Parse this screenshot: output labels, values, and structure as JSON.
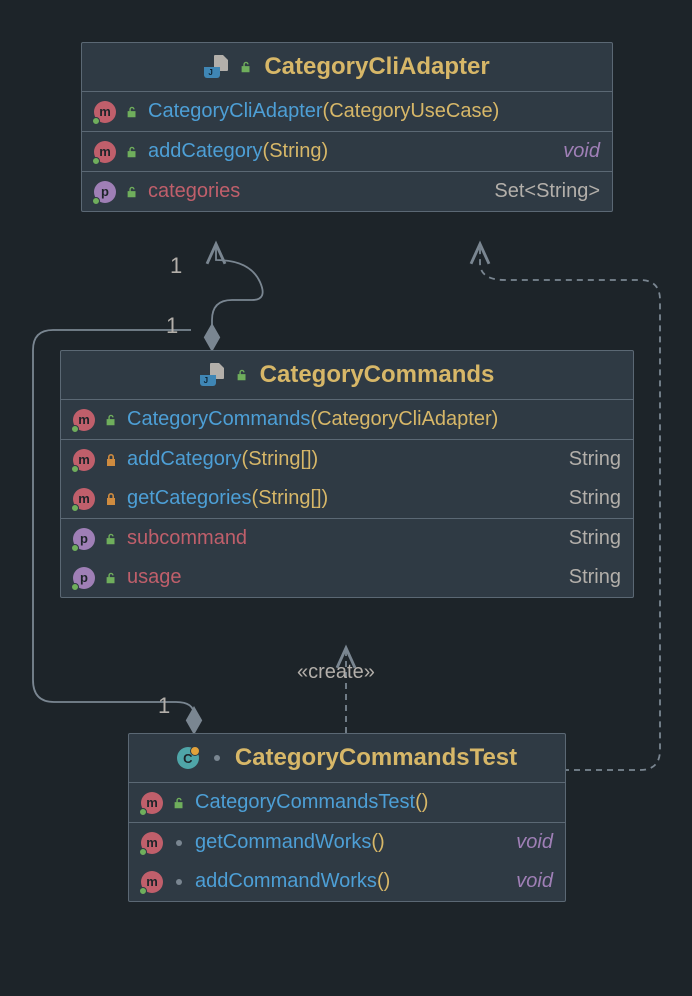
{
  "colors": {
    "bg": "#1d2429",
    "box": "#2f3a44",
    "border": "#5b6874",
    "title": "#d7b768",
    "method": "#4d9fd6",
    "param": "#d7b768",
    "prop": "#c05f6b",
    "type": "#b3afaa",
    "void": "#9f7fb6"
  },
  "classes": {
    "adapter": {
      "title": "CategoryCliAdapter",
      "members": [
        {
          "kind": "m",
          "vis": "open",
          "name": "CategoryCliAdapter",
          "params": "(CategoryUseCase)",
          "rtype": ""
        },
        {
          "kind": "m",
          "vis": "open",
          "name": "addCategory",
          "params": "(String)",
          "rtype": "void"
        },
        {
          "kind": "p",
          "vis": "open",
          "name": "categories",
          "params": "",
          "rtype": "Set<String>"
        }
      ]
    },
    "commands": {
      "title": "CategoryCommands",
      "members": [
        {
          "kind": "m",
          "vis": "open",
          "name": "CategoryCommands",
          "params": "(CategoryCliAdapter)",
          "rtype": ""
        },
        {
          "kind": "m",
          "vis": "lock",
          "name": "addCategory",
          "params": "(String[])",
          "rtype": "String"
        },
        {
          "kind": "m",
          "vis": "lock",
          "name": "getCategories",
          "params": "(String[])",
          "rtype": "String"
        },
        {
          "kind": "p",
          "vis": "open",
          "name": "subcommand",
          "params": "",
          "rtype": "String"
        },
        {
          "kind": "p",
          "vis": "open",
          "name": "usage",
          "params": "",
          "rtype": "String"
        }
      ]
    },
    "test": {
      "title": "CategoryCommandsTest",
      "members": [
        {
          "kind": "m",
          "vis": "open",
          "name": "CategoryCommandsTest",
          "params": "()",
          "rtype": ""
        },
        {
          "kind": "m",
          "vis": "grey",
          "name": "getCommandWorks",
          "params": "()",
          "rtype": "void"
        },
        {
          "kind": "m",
          "vis": "grey",
          "name": "addCommandWorks",
          "params": "()",
          "rtype": "void"
        }
      ]
    }
  },
  "relations": {
    "create_label": "«create»",
    "mult1a": "1",
    "mult1b": "1",
    "mult1c": "1"
  }
}
